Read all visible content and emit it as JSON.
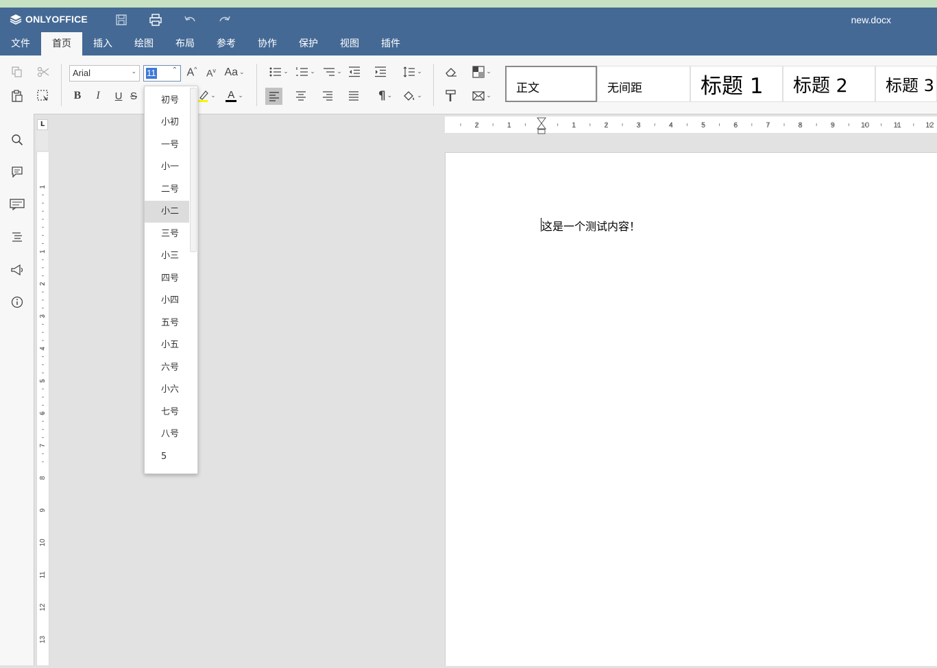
{
  "app": {
    "logo_text": "ONLYOFFICE",
    "document_title": "new.docx"
  },
  "menu": {
    "tabs": [
      {
        "label": "文件"
      },
      {
        "label": "首页"
      },
      {
        "label": "插入"
      },
      {
        "label": "绘图"
      },
      {
        "label": "布局"
      },
      {
        "label": "参考"
      },
      {
        "label": "协作"
      },
      {
        "label": "保护"
      },
      {
        "label": "视图"
      },
      {
        "label": "插件"
      }
    ],
    "active_tab": "首页"
  },
  "toolbar": {
    "font_name": "Arial",
    "font_size": "11",
    "bold_label": "B",
    "italic_label": "I",
    "underline_label": "U",
    "strike_label": "S",
    "case_label": "Aa",
    "grow_label": "A",
    "shrink_label": "A",
    "font_color_label": "A",
    "font_color": "#000000",
    "highlight_color": "#f6f600",
    "styles": [
      {
        "label": "正文"
      },
      {
        "label": "无间距"
      },
      {
        "label": "标题 1"
      },
      {
        "label": "标题 2"
      },
      {
        "label": "标题 3"
      }
    ]
  },
  "font_size_dropdown": {
    "items": [
      "初号",
      "小初",
      "一号",
      "小一",
      "二号",
      "小二",
      "三号",
      "小三",
      "四号",
      "小四",
      "五号",
      "小五",
      "六号",
      "小六",
      "七号",
      "八号",
      "5"
    ],
    "highlighted": "小二"
  },
  "ruler": {
    "h_labels": [
      "2",
      "1",
      "1",
      "2",
      "3",
      "4",
      "5",
      "6",
      "7",
      "8",
      "9",
      "10",
      "11",
      "12"
    ],
    "v_labels": [
      "1",
      "1",
      "2",
      "3",
      "4",
      "5",
      "6",
      "7",
      "8",
      "9",
      "10",
      "11",
      "12",
      "13"
    ],
    "tab_marker": "L"
  },
  "document": {
    "text": "这是一个测试内容！"
  },
  "colors": {
    "header": "#446995",
    "accent_strip": "#c6e2c3",
    "selection": "#3d78d8"
  }
}
